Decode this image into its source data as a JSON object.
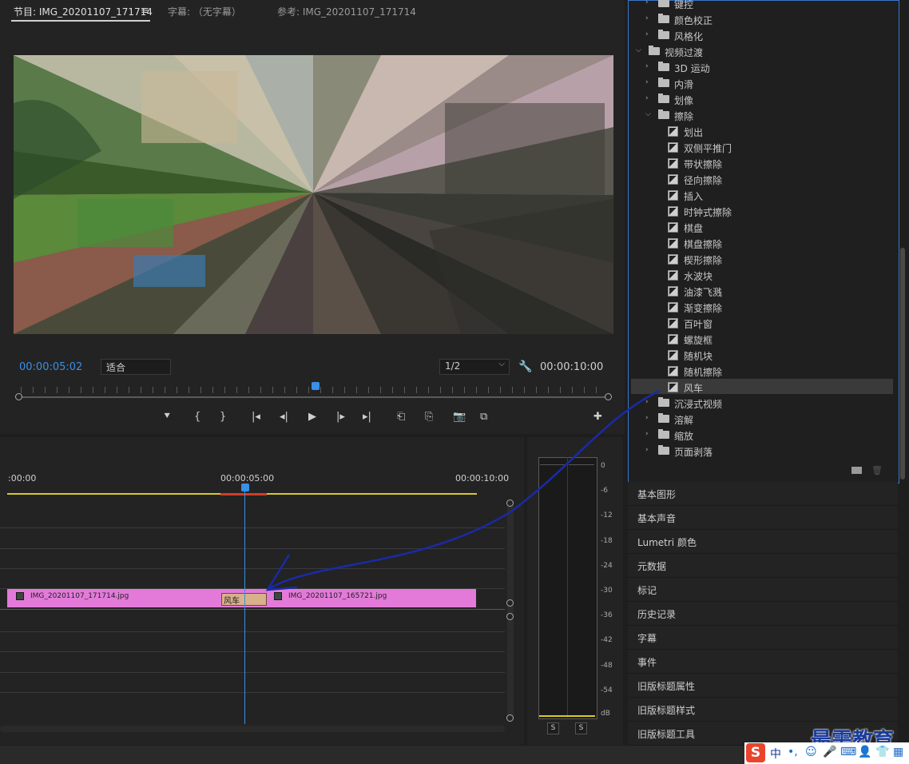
{
  "monitor": {
    "tab_program": "节目: IMG_20201107_171714",
    "tab_captions": "字幕: （无字幕）",
    "tab_reference": "参考: IMG_20201107_171714",
    "menu_icon": "≡",
    "timecode": "00:00:05:02",
    "fit_value": "适合",
    "resolution_value": "1/2",
    "duration": "00:00:10:00",
    "transport": {
      "marker": "⯆",
      "mark_in": "{",
      "mark_out": "}",
      "go_in": "|◂",
      "step_back": "◂|",
      "play": "▶",
      "step_forward": "|▸",
      "go_out": "▸|",
      "lift": "⎗",
      "extract": "⎘",
      "export_frame": "📷",
      "compare": "⧉",
      "add": "✚"
    }
  },
  "effects": {
    "rows": [
      {
        "type": "folder",
        "level": 1,
        "label": "键控",
        "expanded": false
      },
      {
        "type": "folder",
        "level": 1,
        "label": "颜色校正",
        "expanded": false
      },
      {
        "type": "folder",
        "level": 1,
        "label": "风格化",
        "expanded": false
      },
      {
        "type": "folder",
        "level": 0,
        "label": "视频过渡",
        "expanded": true
      },
      {
        "type": "folder",
        "level": 1,
        "label": "3D 运动",
        "expanded": false
      },
      {
        "type": "folder",
        "level": 1,
        "label": "内滑",
        "expanded": false
      },
      {
        "type": "folder",
        "level": 1,
        "label": "划像",
        "expanded": false
      },
      {
        "type": "folder",
        "level": 1,
        "label": "擦除",
        "expanded": true
      },
      {
        "type": "effect",
        "level": 2,
        "label": "划出"
      },
      {
        "type": "effect",
        "level": 2,
        "label": "双侧平推门"
      },
      {
        "type": "effect",
        "level": 2,
        "label": "带状擦除"
      },
      {
        "type": "effect",
        "level": 2,
        "label": "径向擦除"
      },
      {
        "type": "effect",
        "level": 2,
        "label": "插入"
      },
      {
        "type": "effect",
        "level": 2,
        "label": "时钟式擦除"
      },
      {
        "type": "effect",
        "level": 2,
        "label": "棋盘"
      },
      {
        "type": "effect",
        "level": 2,
        "label": "棋盘擦除"
      },
      {
        "type": "effect",
        "level": 2,
        "label": "楔形擦除"
      },
      {
        "type": "effect",
        "level": 2,
        "label": "水波块"
      },
      {
        "type": "effect",
        "level": 2,
        "label": "油漆飞溅"
      },
      {
        "type": "effect",
        "level": 2,
        "label": "渐变擦除"
      },
      {
        "type": "effect",
        "level": 2,
        "label": "百叶窗"
      },
      {
        "type": "effect",
        "level": 2,
        "label": "螺旋框"
      },
      {
        "type": "effect",
        "level": 2,
        "label": "随机块"
      },
      {
        "type": "effect",
        "level": 2,
        "label": "随机擦除"
      },
      {
        "type": "effect",
        "level": 2,
        "label": "风车",
        "selected": true
      },
      {
        "type": "folder",
        "level": 1,
        "label": "沉浸式视频",
        "expanded": false
      },
      {
        "type": "folder",
        "level": 1,
        "label": "溶解",
        "expanded": false
      },
      {
        "type": "folder",
        "level": 1,
        "label": "缩放",
        "expanded": false
      },
      {
        "type": "folder",
        "level": 1,
        "label": "页面剥落",
        "expanded": false
      }
    ]
  },
  "panels": [
    "基本图形",
    "基本声音",
    "Lumetri 颜色",
    "元数据",
    "标记",
    "历史记录",
    "字幕",
    "事件",
    "旧版标题属性",
    "旧版标题样式",
    "旧版标题工具"
  ],
  "timeline": {
    "ruler_start": ":00:00",
    "ruler_mid": "00:00:05:00",
    "ruler_end": "00:00:10:00",
    "clip_a": "IMG_20201107_171714.jpg",
    "clip_b": "IMG_20201107_165721.jpg",
    "transition_label": "风车"
  },
  "meter": {
    "db_labels": [
      "0",
      "-6",
      "-12",
      "-18",
      "-24",
      "-30",
      "-36",
      "-42",
      "-48",
      "-54",
      "dB"
    ],
    "solo_a": "S",
    "solo_b": "S"
  },
  "overlay": {
    "watermark": "最需教育",
    "ime_logo": "S",
    "ime_mode": "中",
    "ime_icons": [
      "•,",
      "☺",
      "🎤",
      "⌨",
      "👤",
      "👕",
      "▦"
    ]
  },
  "colors": {
    "accent_blue": "#3a8fe6",
    "clip_pink": "#e37ad9",
    "ruler_yellow": "#d8c92a",
    "annotation_arrow": "#1a2aa8"
  }
}
